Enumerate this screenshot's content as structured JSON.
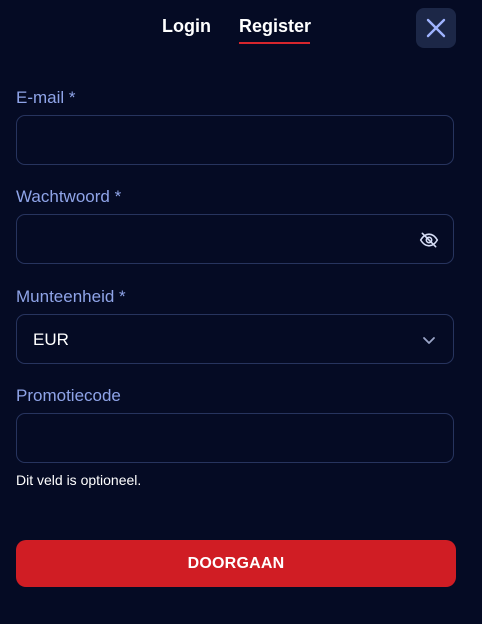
{
  "tabs": {
    "login_label": "Login",
    "register_label": "Register",
    "active": "Register"
  },
  "form": {
    "email": {
      "label": "E-mail *",
      "value": "",
      "placeholder": ""
    },
    "password": {
      "label": "Wachtwoord *",
      "value": "",
      "placeholder": "",
      "toggle_icon": "eye-off-icon"
    },
    "currency": {
      "label": "Munteenheid *",
      "selected": "EUR",
      "icon": "chevron-down-icon"
    },
    "promo": {
      "label": "Promotiecode",
      "value": "",
      "placeholder": "",
      "hint": "Dit veld is optioneel."
    }
  },
  "submit_label": "DOORGAAN",
  "colors": {
    "background": "#050b24",
    "accent": "#d01d24",
    "label": "#8fa4e8",
    "field_border": "#27345e",
    "close_bg": "#1c2747"
  }
}
